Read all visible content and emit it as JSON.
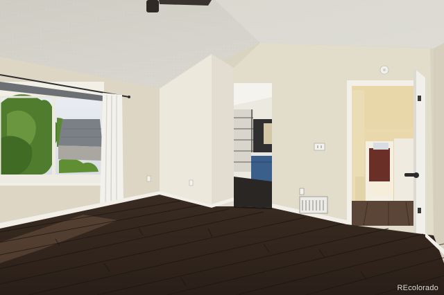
{
  "photo": {
    "subject": "empty-bedroom-interior",
    "watermark": "REcolorado"
  },
  "colors": {
    "ceiling": "#d7d5cd",
    "wall_left": "#ddd6c4",
    "wall_back": "#e2dccb",
    "floor_dark": "#2b211b",
    "floor_light": "#5a4536",
    "trim": "#f1efe8",
    "door": "#f0efe9",
    "vanity_blue": "#3a5f8a",
    "hall_wall": "#e8d9b0",
    "tree_green": "#4f7d2d"
  },
  "icons": {
    "fan": "ceiling-fan-icon",
    "smoke": "smoke-detector-icon",
    "outlet": "outlet-icon",
    "vent": "floor-vent-icon",
    "switch": "light-switch-icon"
  }
}
